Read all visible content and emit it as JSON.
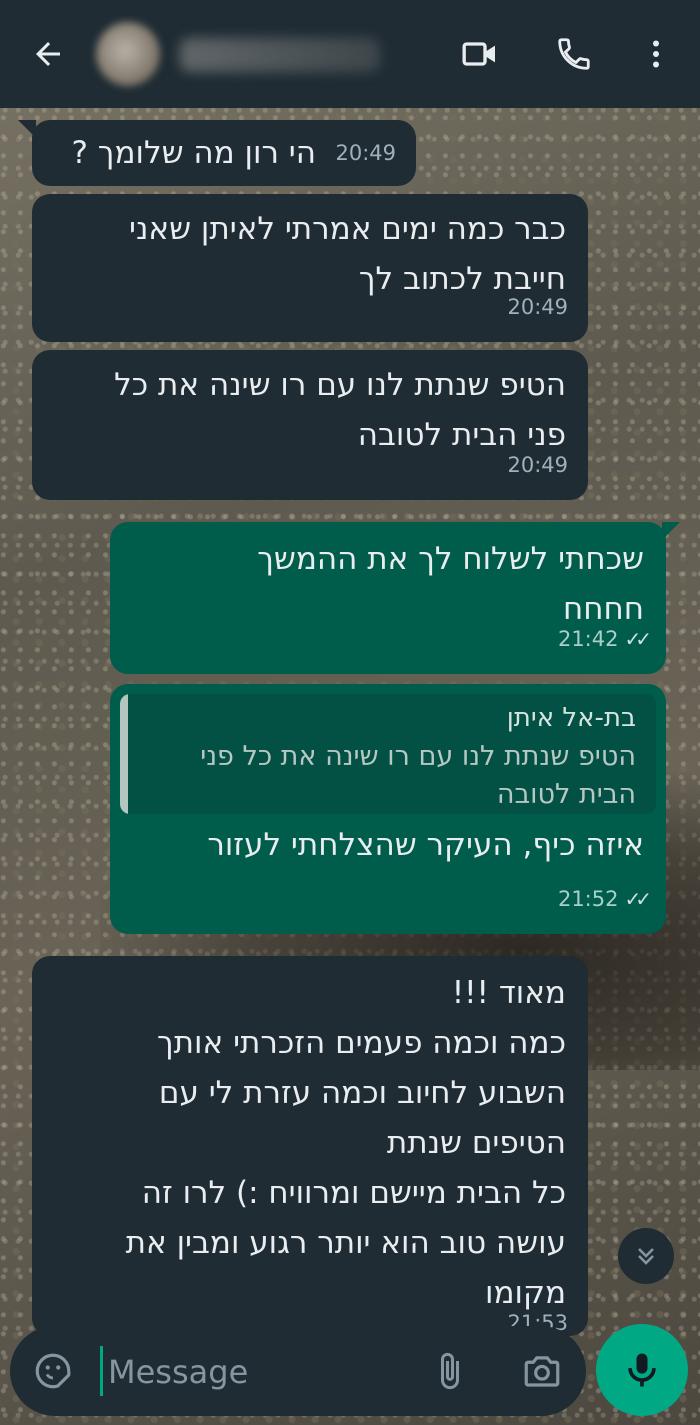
{
  "header": {
    "contact_name": "",
    "icons": [
      "back-arrow-icon",
      "video-call-icon",
      "voice-call-icon",
      "more-options-icon"
    ]
  },
  "messages": [
    {
      "direction": "incoming",
      "text": "הי רון מה שלומך ?",
      "time": "20:49"
    },
    {
      "direction": "incoming",
      "text": "כבר כמה ימים אמרתי לאיתן שאני\nחייבת לכתוב לך",
      "time": "20:49"
    },
    {
      "direction": "incoming",
      "text": "הטיפ שנתת לנו עם רו שינה את כל\nפני הבית לטובה",
      "time": "20:49"
    },
    {
      "direction": "outgoing",
      "text": "שכחתי לשלוח לך את ההמשך\nחחחח",
      "time": "21:42",
      "status": "read"
    },
    {
      "direction": "outgoing",
      "reply_to": {
        "sender": "בת-אל איתן",
        "text": "הטיפ שנתת לנו עם רו שינה את כל פני\nהבית לטובה"
      },
      "text": "איזה כיף, העיקר שהצלחתי לעזור",
      "time": "21:52",
      "status": "read"
    },
    {
      "direction": "incoming",
      "text": "מאוד !!!\nכמה וכמה פעמים הזכרתי אותך\nהשבוע לחיוב וכמה עזרת לי עם\nהטיפים שנתת\nכל הבית מיישם ומרוויח :) לרו זה\nעושה טוב הוא יותר רגוע ומבין את\nמקומו",
      "time": "21:53"
    }
  ],
  "composer": {
    "placeholder": "Message",
    "value": ""
  },
  "colors": {
    "header_bg": "#1f2c33",
    "incoming_bubble": "#202c33",
    "outgoing_bubble": "#005c4b",
    "accent": "#00a884"
  }
}
